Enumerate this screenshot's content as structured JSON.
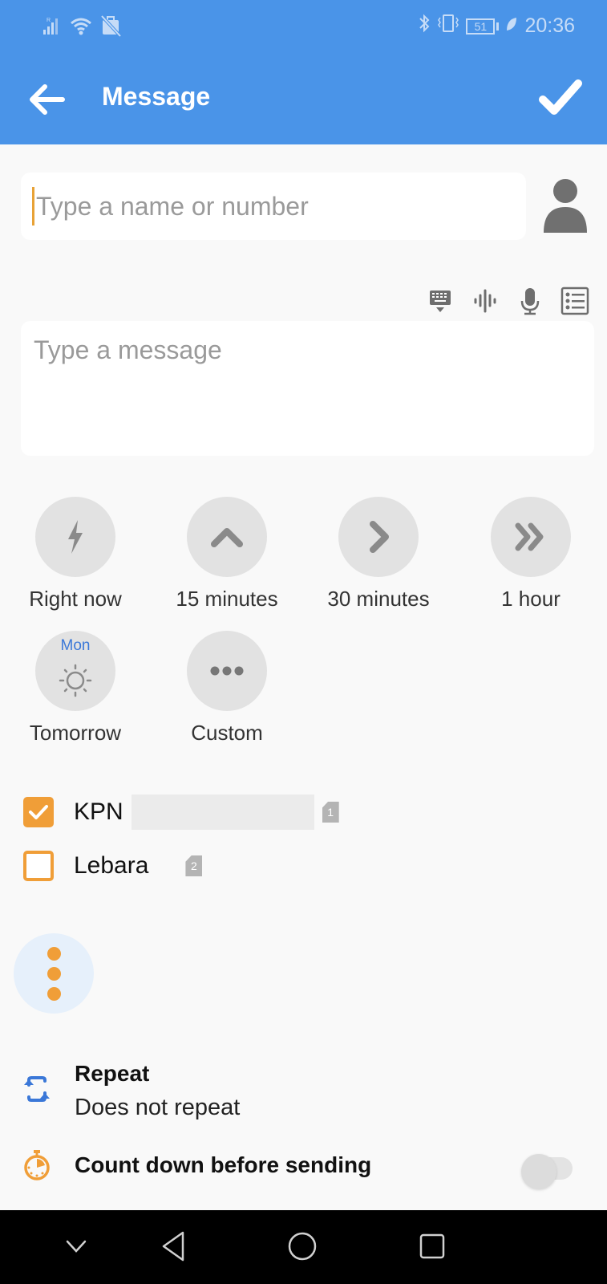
{
  "status_bar": {
    "icons_left": [
      "signal-roaming-icon",
      "wifi-icon",
      "no-sim-icon"
    ],
    "icons_right": [
      "bluetooth-icon",
      "vibrate-icon",
      "battery-icon",
      "battery-saver-leaf-icon"
    ],
    "battery_level": "51",
    "time": "20:36"
  },
  "app_bar": {
    "title": "Message",
    "back_icon": "arrow-left-icon",
    "confirm_icon": "checkmark-icon"
  },
  "recipient": {
    "placeholder": "Type a name or number",
    "value": "",
    "contact_picker_icon": "person-icon"
  },
  "message_tools": [
    {
      "name": "keyboard-icon"
    },
    {
      "name": "voice-waveform-icon"
    },
    {
      "name": "microphone-icon"
    },
    {
      "name": "template-list-icon"
    }
  ],
  "message": {
    "placeholder": "Type a message",
    "value": ""
  },
  "schedule_options": [
    {
      "label": "Right now",
      "icon": "lightning-icon"
    },
    {
      "label": "15 minutes",
      "icon": "chevron-up-icon"
    },
    {
      "label": "30 minutes",
      "icon": "chevron-right-icon"
    },
    {
      "label": "1 hour",
      "icon": "double-chevron-right-icon"
    },
    {
      "label": "Tomorrow",
      "icon": "sun-icon",
      "day": "Mon"
    },
    {
      "label": "Custom",
      "icon": "ellipsis-icon"
    }
  ],
  "sims": [
    {
      "name": "KPN",
      "checked": true,
      "slot": "1",
      "redacted": true
    },
    {
      "name": "Lebara",
      "checked": false,
      "slot": "2"
    }
  ],
  "more_options": {
    "icon": "vertical-dots-icon"
  },
  "repeat": {
    "title": "Repeat",
    "value": "Does not repeat",
    "icon": "repeat-icon"
  },
  "countdown": {
    "label": "Count down before sending",
    "enabled": false,
    "icon": "stopwatch-icon"
  },
  "nav_bar": {
    "buttons": [
      "hide-keyboard-icon",
      "back-triangle-icon",
      "home-circle-icon",
      "recents-square-icon"
    ]
  },
  "colors": {
    "primary": "#4a94e8",
    "accent": "#f09e38",
    "day_label": "#3b78d8"
  }
}
